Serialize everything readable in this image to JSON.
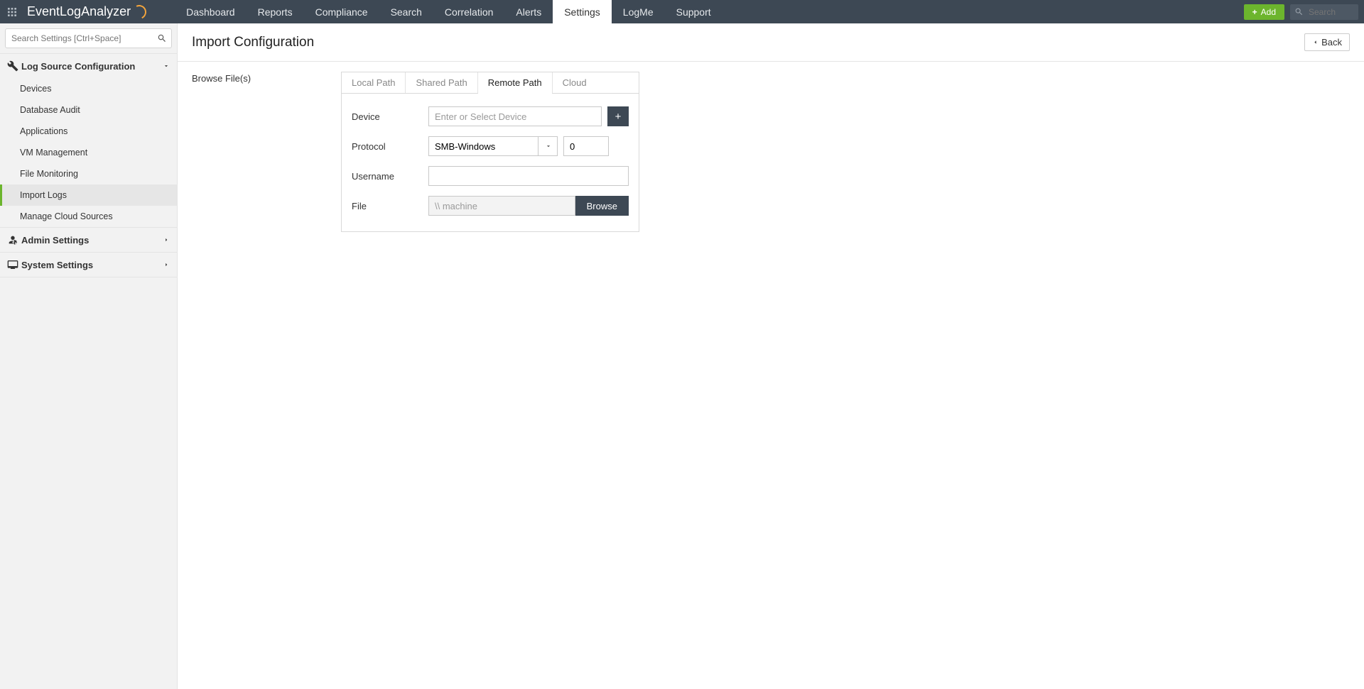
{
  "brand": {
    "part1": "EventLog",
    "part2": " Analyzer"
  },
  "nav": {
    "items": [
      "Dashboard",
      "Reports",
      "Compliance",
      "Search",
      "Correlation",
      "Alerts",
      "Settings",
      "LogMe",
      "Support"
    ],
    "active_index": 6,
    "add_label": "Add",
    "search_placeholder": "Search"
  },
  "sidebar": {
    "search_placeholder": "Search Settings [Ctrl+Space]",
    "sections": [
      {
        "label": "Log Source Configuration",
        "expanded": true,
        "items": [
          "Devices",
          "Database Audit",
          "Applications",
          "VM Management",
          "File Monitoring",
          "Import Logs",
          "Manage Cloud Sources"
        ],
        "active_index": 5
      },
      {
        "label": "Admin Settings",
        "expanded": false,
        "items": []
      },
      {
        "label": "System Settings",
        "expanded": false,
        "items": []
      }
    ]
  },
  "page": {
    "title": "Import Configuration",
    "back_label": "Back",
    "browse_label": "Browse File(s)"
  },
  "tabs": {
    "items": [
      "Local Path",
      "Shared Path",
      "Remote Path",
      "Cloud"
    ],
    "active_index": 2
  },
  "form": {
    "device_label": "Device",
    "device_placeholder": "Enter or Select Device",
    "protocol_label": "Protocol",
    "protocol_value": "SMB-Windows",
    "port_value": "0",
    "username_label": "Username",
    "file_label": "File",
    "file_placeholder": "\\\\ machine",
    "browse_label": "Browse"
  }
}
